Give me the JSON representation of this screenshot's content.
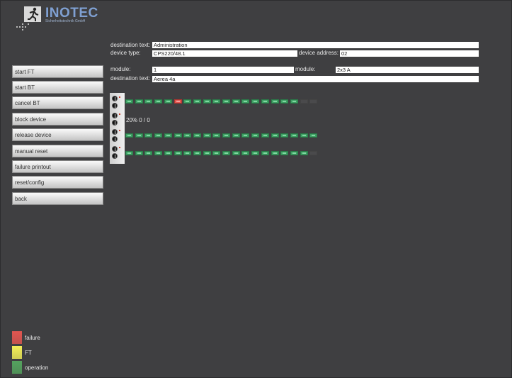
{
  "logo": {
    "brand": "INOTEC",
    "subtitle": "Sicherheitstechnik GmbH"
  },
  "device": {
    "destination_label": "destination text:",
    "destination_value": "Administration",
    "type_label": "device type:",
    "type_value": "CPS220/48.1",
    "address_label": "device address:",
    "address_value": "02"
  },
  "module": {
    "module_label": "module:",
    "module_value": "1",
    "module2_label": "module:",
    "module2_value": "2x3 A",
    "destination_label": "destination text:",
    "destination_value": "Aerea 4a"
  },
  "menu": {
    "items": [
      {
        "label": "start FT"
      },
      {
        "label": "start BT"
      },
      {
        "label": "cancel BT"
      },
      {
        "label": "block device"
      },
      {
        "label": "release device"
      },
      {
        "label": "manual reset"
      },
      {
        "label": "failure printout"
      },
      {
        "label": "reset/config"
      },
      {
        "label": "back"
      }
    ]
  },
  "circuits": {
    "status_text": "20% 0 / 0",
    "rows": [
      [
        "operation",
        "operation",
        "operation",
        "operation",
        "operation",
        "failure",
        "operation",
        "operation",
        "operation",
        "operation",
        "operation",
        "operation",
        "operation",
        "operation",
        "operation",
        "operation",
        "operation",
        "operation",
        "empty",
        "empty"
      ],
      [
        "operation",
        "operation",
        "operation",
        "operation",
        "operation",
        "operation",
        "operation",
        "operation",
        "operation",
        "operation",
        "operation",
        "operation",
        "operation",
        "operation",
        "operation",
        "operation",
        "operation",
        "operation",
        "operation",
        "operation"
      ],
      [
        "operation",
        "operation",
        "operation",
        "operation",
        "operation",
        "operation",
        "operation",
        "operation",
        "operation",
        "operation",
        "operation",
        "operation",
        "operation",
        "operation",
        "operation",
        "operation",
        "operation",
        "operation",
        "operation",
        "empty"
      ]
    ]
  },
  "legend": {
    "items": [
      {
        "label": "failure",
        "color": "#e25650"
      },
      {
        "label": "FT",
        "color": "#f3ee58"
      },
      {
        "label": "operation",
        "color": "#54a35e"
      }
    ]
  }
}
